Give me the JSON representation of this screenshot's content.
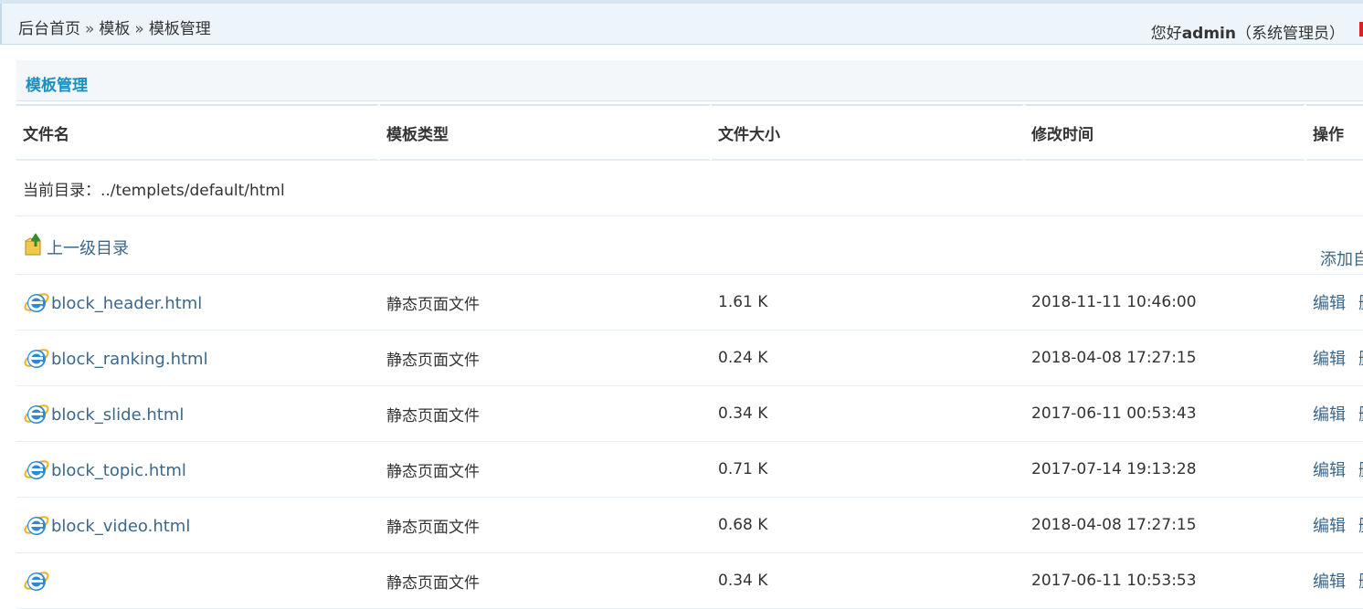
{
  "breadcrumb": {
    "items": [
      "后台首页",
      "模板",
      "模板管理"
    ],
    "separator": "»"
  },
  "user": {
    "greeting": "您好",
    "name": "admin",
    "role": "（系统管理员）"
  },
  "panel": {
    "title": "模板管理"
  },
  "table": {
    "headers": [
      "文件名",
      "模板类型",
      "文件大小",
      "修改时间",
      "操作"
    ],
    "current_dir_label": "当前目录：../templets/default/html",
    "parent_dir_label": "上一级目录",
    "add_label": "添加自",
    "rows": [
      {
        "name": "block_header.html",
        "type": "静态页面文件",
        "size": "1.61 K",
        "mtime": "2018-11-11 10:46:00",
        "edit": "编辑",
        "other": "删"
      },
      {
        "name": "block_ranking.html",
        "type": "静态页面文件",
        "size": "0.24 K",
        "mtime": "2018-04-08 17:27:15",
        "edit": "编辑",
        "other": "删"
      },
      {
        "name": "block_slide.html",
        "type": "静态页面文件",
        "size": "0.34 K",
        "mtime": "2017-06-11 00:53:43",
        "edit": "编辑",
        "other": "删"
      },
      {
        "name": "block_topic.html",
        "type": "静态页面文件",
        "size": "0.71 K",
        "mtime": "2017-07-14 19:13:28",
        "edit": "编辑",
        "other": "删"
      },
      {
        "name": "block_video.html",
        "type": "静态页面文件",
        "size": "0.68 K",
        "mtime": "2018-04-08 17:27:15",
        "edit": "编辑",
        "other": "删"
      },
      {
        "name": "",
        "type": "静态页面文件",
        "size": "0.34 K",
        "mtime": "2017-06-11 10:53:53",
        "edit": "编辑",
        "other": "删"
      }
    ]
  },
  "colors": {
    "accent": "#1a8fc4",
    "link": "#3d6789",
    "topbar_bg": "#eef5fa"
  },
  "icons": {
    "file": "ie-html-icon",
    "parent": "folder-up-icon"
  }
}
